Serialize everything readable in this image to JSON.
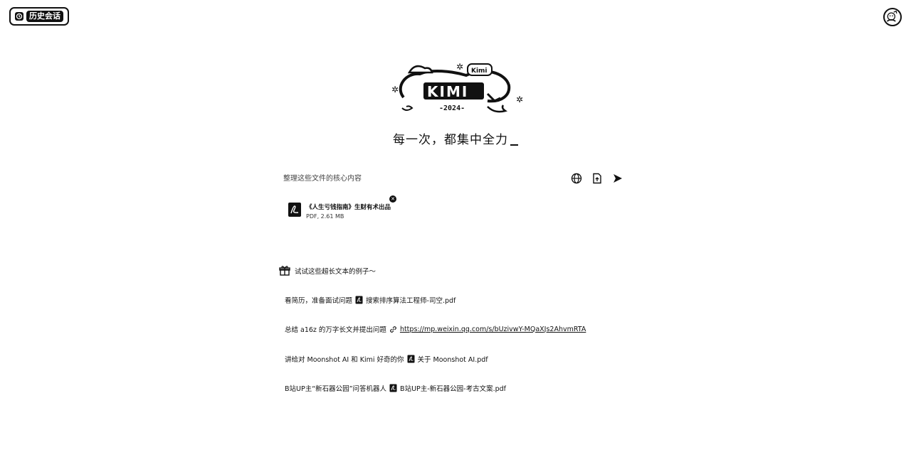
{
  "header": {
    "history_label": "历史会话"
  },
  "logo": {
    "badge_text": "Kimi",
    "year_text": "-2024-"
  },
  "hero": {
    "slogan": "每一次，都集中全力"
  },
  "input": {
    "value": "整理这些文件的核心内容"
  },
  "attachment": {
    "name": "《人生亏钱指南》生财有术出品",
    "meta": "PDF, 2.61 MB"
  },
  "examples": {
    "heading": "试试这些超长文本的例子～",
    "items": [
      {
        "prompt": "看简历，准备面试问题",
        "icon": "pdf-icon",
        "target": "搜索排序算法工程师-司空.pdf"
      },
      {
        "prompt": "总结 a16z 的万字长文并提出问题",
        "icon": "link-icon",
        "target": "https://mp.weixin.qq.com/s/bUzivwY-MQaXJs2AhvmRTA"
      },
      {
        "prompt": "讲给对 Moonshot AI 和 Kimi 好奇的你",
        "icon": "pdf-icon",
        "target": "关于 Moonshot AI.pdf"
      },
      {
        "prompt": "B站UP主“新石器公园”问答机器人",
        "icon": "pdf-icon",
        "target": "B站UP主-新石器公园-考古文案.pdf"
      }
    ]
  }
}
